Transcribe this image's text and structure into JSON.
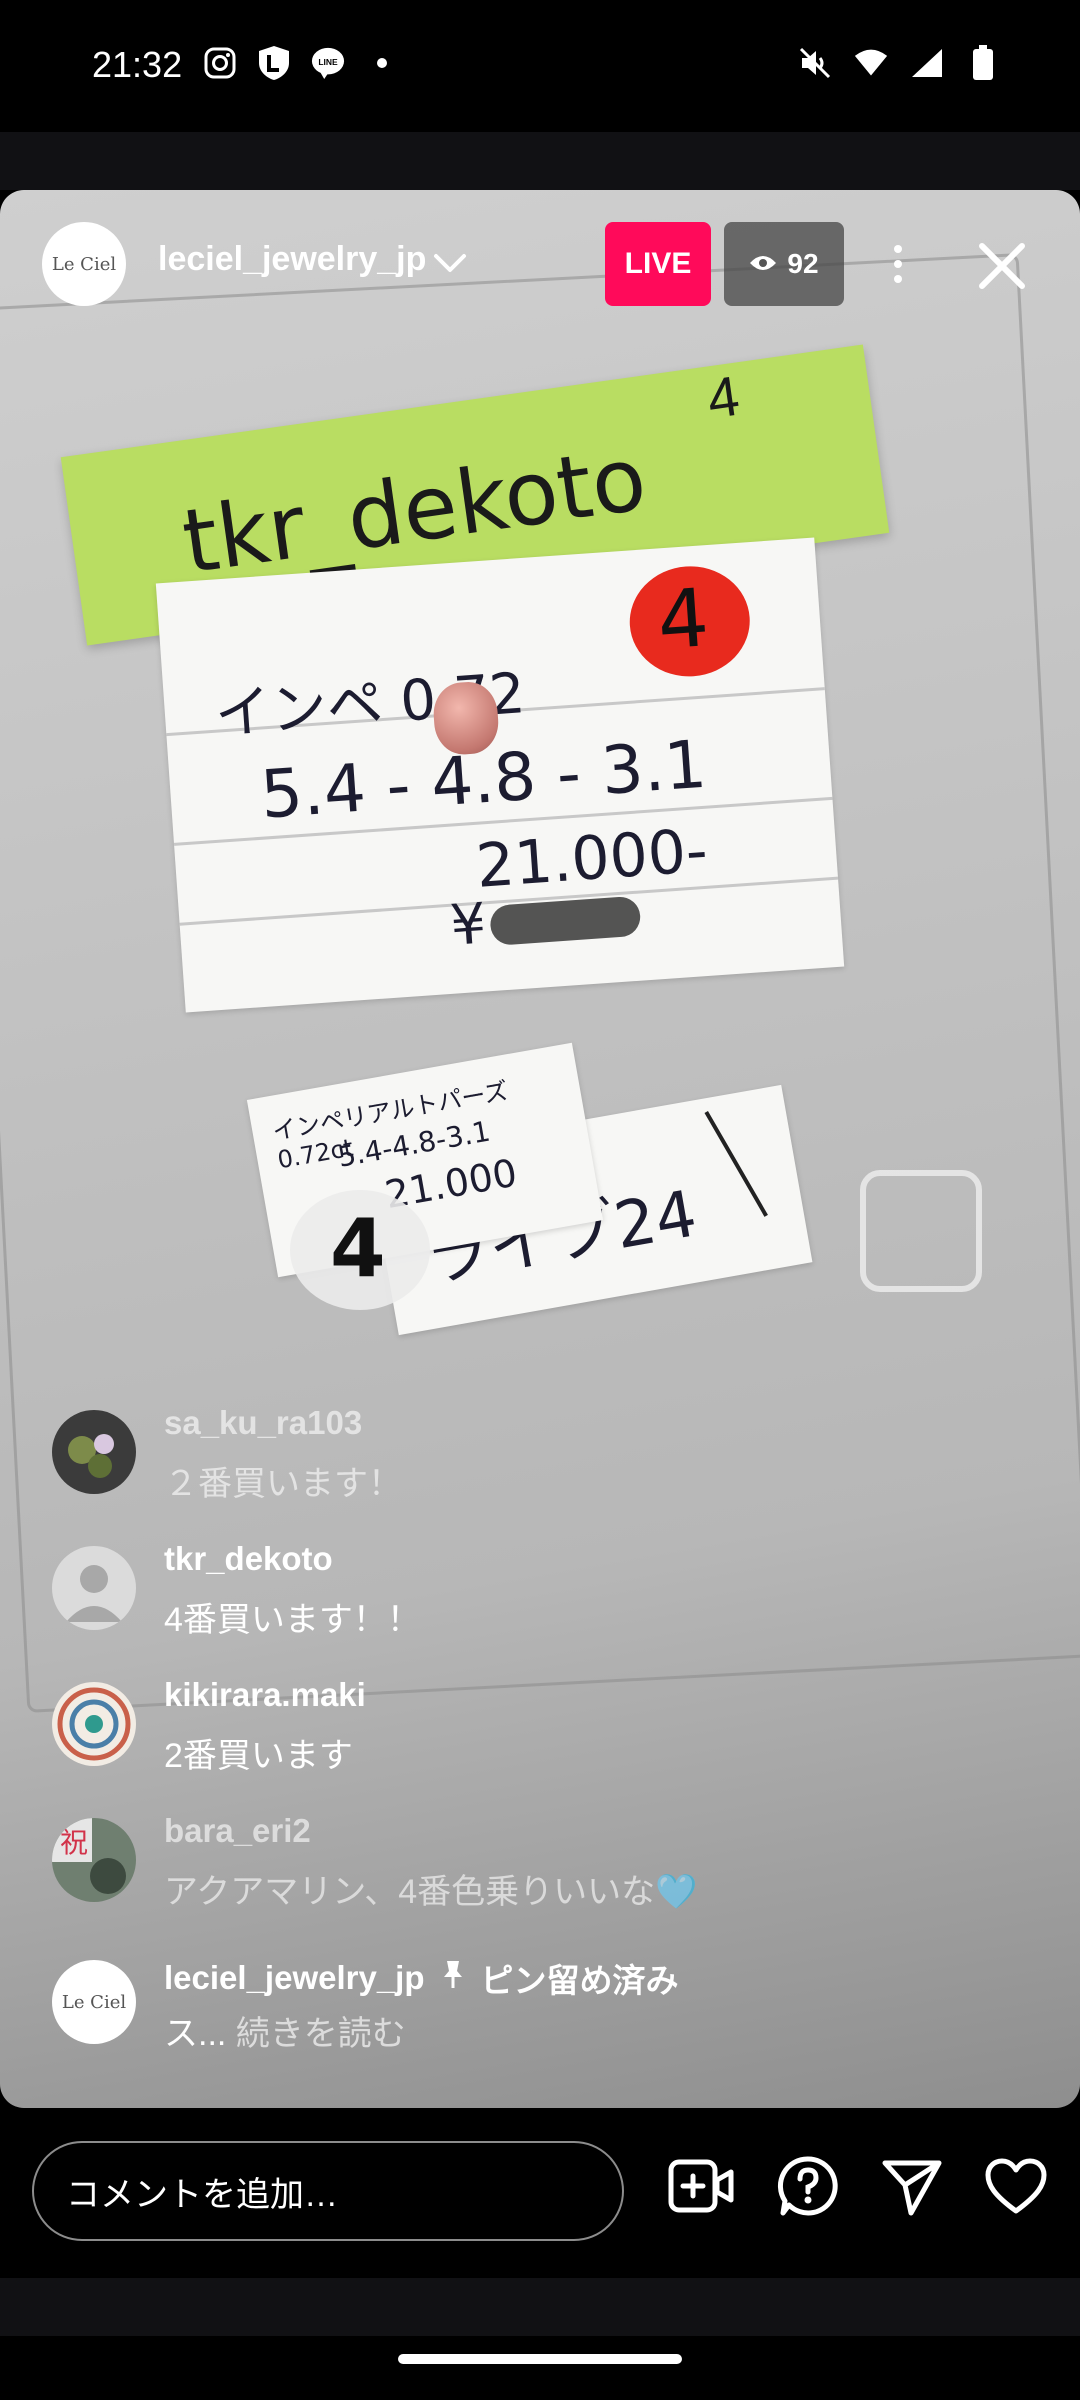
{
  "status_bar": {
    "time": "21:32",
    "left_icons": [
      "instagram-icon",
      "shield-l-icon",
      "line-icon",
      "dot-icon"
    ],
    "right_icons": [
      "mute-icon",
      "wifi-icon",
      "signal-icon",
      "battery-icon"
    ]
  },
  "live": {
    "host_username": "leciel_jewelry_jp",
    "host_avatar_text": "Le Ciel",
    "live_label": "LIVE",
    "viewer_count": "92"
  },
  "video_scene": {
    "sticky_note": "tkr_dekoto",
    "sticky_number": "4",
    "red_marker": "4",
    "line1": "インペ 0.72",
    "line2": "5.4 - 4.8 - 3.1",
    "line3": "21.000-",
    "line4": "¥",
    "label_small_1": "インペリアルトパーズ 0.72ct",
    "label_small_2": "5.4-4.8-3.1",
    "label_small_3": "21.000",
    "sticker_number": "4",
    "label_live": "ライブ24"
  },
  "comments": [
    {
      "username": "sa_ku_ra103",
      "text": "２番買います！",
      "avatar": "flower-photo",
      "dimmed": true
    },
    {
      "username": "tkr_dekoto",
      "text": "4番買います！！",
      "avatar": "default-user",
      "dimmed": false
    },
    {
      "username": "kikirara.maki",
      "text": "2番買います",
      "avatar": "mandala-photo",
      "dimmed": false
    },
    {
      "username": "bara_eri2",
      "text": "アクアマリン、4番色乗りいいな🩵",
      "avatar": "celebration-photo",
      "dimmed": true
    }
  ],
  "pinned_comment": {
    "username": "leciel_jewelry_jp",
    "pinned_label": "ピン留め済み",
    "text": "ス...",
    "read_more": "続きを読む"
  },
  "bottom_bar": {
    "comment_placeholder": "コメントを追加…",
    "icons": [
      "add-video-icon",
      "question-icon",
      "send-icon",
      "heart-icon"
    ]
  }
}
